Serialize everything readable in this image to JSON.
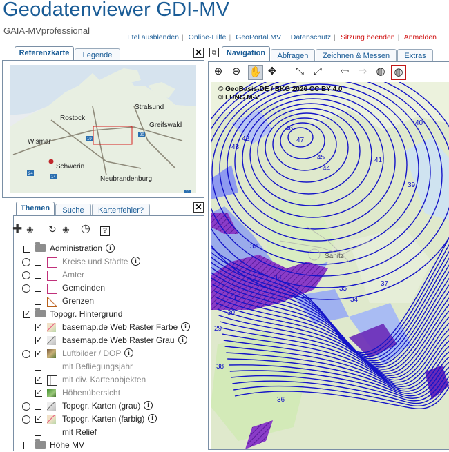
{
  "header": {
    "title": "Geodatenviewer GDI-MV",
    "subtitle": "GAIA-MVprofessional",
    "links": [
      {
        "label": "Titel ausblenden",
        "color": "#1a5c96"
      },
      {
        "label": "Online-Hilfe",
        "color": "#1a5c96"
      },
      {
        "label": "GeoPortal.MV",
        "color": "#1a5c96"
      },
      {
        "label": "Datenschutz",
        "color": "#1a5c96"
      },
      {
        "label": "Sitzung beenden",
        "color": "#d01010"
      },
      {
        "label": "Anmelden",
        "color": "#d01010"
      }
    ]
  },
  "overview": {
    "tabs": [
      "Referenzkarte",
      "Legende"
    ],
    "close": "✕",
    "cities": [
      "Stralsund",
      "Rostock",
      "Greifswald",
      "Wismar",
      "Schwerin",
      "Neubrandenburg"
    ],
    "road_badges": [
      "19",
      "20",
      "24",
      "14",
      "11"
    ]
  },
  "layers": {
    "tabs": [
      "Themen",
      "Suche",
      "Kartenfehler?"
    ],
    "close": "✕",
    "toolbar_icons": [
      "add-layer-icon",
      "layers-icon",
      "refresh-icon",
      "layers-stack-icon",
      "clock-icon",
      "help-icon"
    ],
    "items": [
      {
        "label": "Administration",
        "type": "folder",
        "state": "open",
        "info": true,
        "gray": false
      },
      {
        "label": "Kreise und Städte",
        "type": "layer",
        "control": "radio",
        "symbol": "pink-square",
        "info": true,
        "gray": true
      },
      {
        "label": "Ämter",
        "type": "layer",
        "control": "radio",
        "symbol": "pink-square",
        "info": false,
        "gray": true
      },
      {
        "label": "Gemeinden",
        "type": "layer",
        "control": "radio",
        "symbol": "pink-square",
        "info": false,
        "gray": false
      },
      {
        "label": "Grenzen",
        "type": "layer",
        "control": "none",
        "symbol": "hatch-orange",
        "info": false,
        "gray": false
      },
      {
        "label": "Topogr. Hintergrund",
        "type": "folder",
        "state": "checked",
        "info": false,
        "gray": false
      },
      {
        "label": "basemap.de Web Raster Farbe",
        "type": "layer",
        "control": "check",
        "symbol": "map-color",
        "info": true,
        "gray": false
      },
      {
        "label": "basemap.de Web Raster Grau",
        "type": "layer",
        "control": "check",
        "symbol": "map-gray",
        "info": true,
        "gray": false
      },
      {
        "label": "Luftbilder / DOP",
        "type": "layer",
        "control": "radio-check",
        "symbol": "photo",
        "info": true,
        "gray": true
      },
      {
        "label": "mit Befliegungsjahr",
        "type": "sublayer",
        "control": "none",
        "symbol": "none",
        "info": false,
        "gray": true
      },
      {
        "label": "mit div. Kartenobjekten",
        "type": "sublayer",
        "control": "check",
        "symbol": "grid",
        "info": false,
        "gray": true
      },
      {
        "label": "Höhenübersicht",
        "type": "sublayer",
        "control": "check",
        "symbol": "green",
        "info": false,
        "gray": true
      },
      {
        "label": "Topogr. Karten (grau)",
        "type": "layer",
        "control": "radio",
        "symbol": "map-gray",
        "info": true,
        "gray": false
      },
      {
        "label": "Topogr. Karten (farbig)",
        "type": "layer",
        "control": "radio-check",
        "symbol": "map-color",
        "info": true,
        "gray": false
      },
      {
        "label": "mit Relief",
        "type": "sublayer",
        "control": "none",
        "symbol": "none",
        "info": false,
        "gray": false
      },
      {
        "label": "Höhe MV",
        "type": "folder",
        "state": "open",
        "info": false,
        "gray": false
      }
    ]
  },
  "map": {
    "tabs": [
      "Navigation",
      "Abfragen",
      "Zeichnen & Messen",
      "Extras"
    ],
    "toolbar_icons": [
      "zoom-in-icon",
      "zoom-out-icon",
      "pan-hand-icon",
      "move-icon",
      "zoom-extent-icon",
      "full-extent-icon",
      "back-arrow-icon",
      "forward-arrow-icon",
      "globe-icon",
      "globe-select-icon"
    ],
    "attribution": [
      "© GeoBasis-DE / BKG 2026 CC BY 4.0",
      "© LUNG M-V"
    ],
    "place": "Sanitz",
    "contour_labels": [
      "46",
      "47",
      "45",
      "44",
      "43",
      "42",
      "41",
      "40",
      "39",
      "38",
      "37",
      "36",
      "35",
      "34",
      "33",
      "32",
      "31",
      "30",
      "29"
    ],
    "colors": {
      "contour": "#1414c8",
      "water": "#7aa0ff",
      "hatch": "#6a2ab8"
    }
  }
}
